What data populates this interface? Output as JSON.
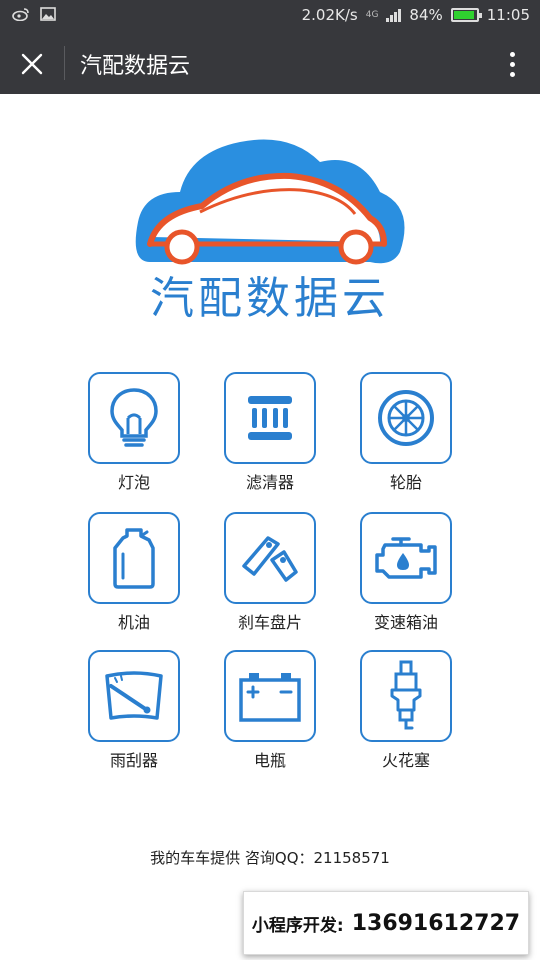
{
  "status_bar": {
    "speed": "2.02K/s",
    "network_type": "4G",
    "battery_percent": "84%",
    "battery_level": 0.84,
    "time": "11:05",
    "icons": [
      "weibo-icon",
      "image-icon",
      "signal-icon",
      "battery-icon"
    ]
  },
  "title_bar": {
    "title": "汽配数据云",
    "close_icon": "close-icon",
    "more_icon": "more-vertical-icon"
  },
  "logo": {
    "text": "汽配数据云",
    "colors": {
      "cloud": "#2a8fe0",
      "car": "#e8552a"
    }
  },
  "grid": {
    "items": [
      {
        "label": "灯泡",
        "icon": "light-bulb-icon"
      },
      {
        "label": "滤清器",
        "icon": "filter-icon"
      },
      {
        "label": "轮胎",
        "icon": "tire-icon"
      },
      {
        "label": "机油",
        "icon": "oil-bottle-icon"
      },
      {
        "label": "刹车盘片",
        "icon": "brake-pad-icon"
      },
      {
        "label": "变速箱油",
        "icon": "transmission-oil-icon"
      },
      {
        "label": "雨刮器",
        "icon": "wiper-icon"
      },
      {
        "label": "电瓶",
        "icon": "battery-icon"
      },
      {
        "label": "火花塞",
        "icon": "spark-plug-icon"
      }
    ]
  },
  "footer": {
    "text": "我的车车提供 咨询QQ：21158571"
  },
  "dev_banner": {
    "label": "小程序开发:",
    "phone": "13691612727"
  },
  "colors": {
    "accent": "#2a7fcf",
    "header": "#37383c"
  }
}
